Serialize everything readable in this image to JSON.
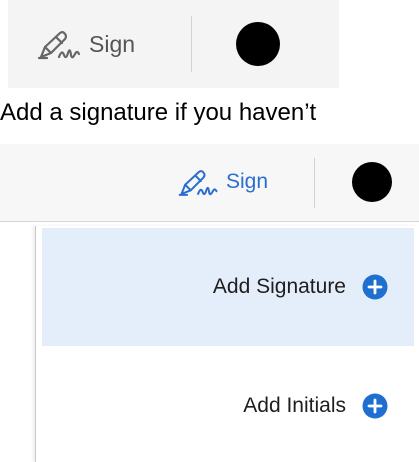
{
  "top_toolbar": {
    "sign_label": "Sign",
    "icon_color": "#555555"
  },
  "caption": {
    "text": "Add a signature if you haven’t"
  },
  "bottom_toolbar": {
    "sign_label": "Sign",
    "accent_color": "#2a6fcf"
  },
  "dropdown": {
    "items": [
      {
        "label": "Add Signature",
        "icon": "plus-circle-icon",
        "highlighted": true
      },
      {
        "label": "Add Initials",
        "icon": "plus-circle-icon",
        "highlighted": false
      }
    ],
    "highlight_color": "#e3eefa",
    "icon_color": "#1f6fd1"
  }
}
